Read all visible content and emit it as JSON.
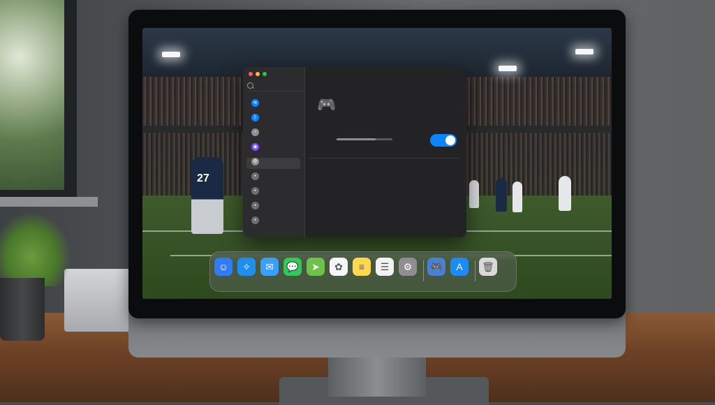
{
  "screen": {
    "settings_window": {
      "traffic_lights": {
        "close": "#ff5f57",
        "minimize": "#febc2e",
        "zoom": "#28c840"
      },
      "sidebar": {
        "items": [
          {
            "icon": "wifi-icon",
            "color": "#0a84ff"
          },
          {
            "icon": "bluetooth-icon",
            "color": "#0a84ff"
          },
          {
            "icon": "screen-time-icon",
            "color": "#8e8e93"
          },
          {
            "icon": "siri-icon",
            "color": "#7a4dff"
          },
          {
            "icon": "gear-icon",
            "color": "#8e8e93",
            "selected": true
          },
          {
            "icon": "settings-item-icon",
            "color": "#6e6e73"
          },
          {
            "icon": "settings-item-icon",
            "color": "#6e6e73"
          },
          {
            "icon": "settings-item-icon",
            "color": "#6e6e73"
          },
          {
            "icon": "settings-item-icon",
            "color": "#6e6e73"
          }
        ]
      },
      "content": {
        "header_icon": "gamepad-icon",
        "slider_level": 0.7,
        "toggle_on": true,
        "toggle_color": "#0a84ff"
      }
    },
    "dock": {
      "apps": [
        {
          "name": "Finder",
          "icon": "finder-icon",
          "color": "#2f7cf6"
        },
        {
          "name": "Safari",
          "icon": "safari-icon",
          "color": "#1f8ef1"
        },
        {
          "name": "Mail",
          "icon": "mail-icon",
          "color": "#3aa0ff"
        },
        {
          "name": "Messages",
          "icon": "messages-icon",
          "color": "#34c759"
        },
        {
          "name": "Maps",
          "icon": "maps-icon",
          "color": "#6cc24a"
        },
        {
          "name": "Photos",
          "icon": "photos-icon",
          "color": "#f6f6f6"
        },
        {
          "name": "Notes",
          "icon": "notes-icon",
          "color": "#ffd84d"
        },
        {
          "name": "Reminders",
          "icon": "reminders-icon",
          "color": "#f2f2f2"
        },
        {
          "name": "System Settings",
          "icon": "settings-icon",
          "color": "#8e8e93"
        },
        {
          "name": "Game",
          "icon": "game-controller-icon",
          "color": "#4a7fd6"
        },
        {
          "name": "App Store",
          "icon": "app-store-icon",
          "color": "#1c8cf5"
        },
        {
          "name": "Trash",
          "icon": "trash-icon",
          "color": "#d9d9d9"
        }
      ]
    },
    "wallpaper": {
      "player_number": "27"
    }
  }
}
